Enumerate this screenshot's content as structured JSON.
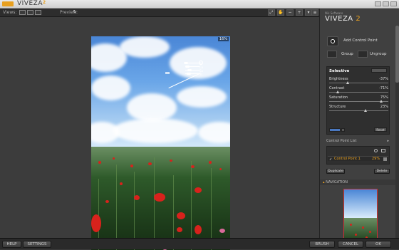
{
  "app": {
    "title": "VIVEZA",
    "version_mark": "2"
  },
  "toolbar": {
    "views_label": "Views:",
    "preview_label": "Preview:"
  },
  "canvas": {
    "zoom": "16%"
  },
  "control_point_tags": [
    "Br",
    "Co",
    "Sa",
    "St"
  ],
  "panel": {
    "brand_small": "Nik Software",
    "brand_name": "VIVEZA",
    "brand_version": "2",
    "add_control_point": "Add Control Point",
    "group": "Group",
    "ungroup": "Ungroup",
    "selective_title": "Selective",
    "sliders": [
      {
        "name": "Brightness",
        "value": "-37%",
        "level": 0.315
      },
      {
        "name": "Contrast",
        "value": "-71%",
        "level": 0.145
      },
      {
        "name": "Saturation",
        "value": "75%",
        "level": 0.875
      },
      {
        "name": "Structure",
        "value": "23%",
        "level": 0.615
      }
    ],
    "reset": "Reset",
    "control_point_list_title": "Control Point List",
    "control_point_row": {
      "check": "✓",
      "name": "Control Point 1",
      "percent": "29%"
    },
    "duplicate": "Duplicate",
    "delete": "Delete",
    "navigation_title": "NAVIGATION"
  },
  "bottom": {
    "help": "HELP",
    "settings": "SETTINGS",
    "brush": "BRUSH",
    "cancel": "CANCEL",
    "ok": "OK"
  },
  "colors": {
    "accent": "#e8a020",
    "selection_blue": "#4a78c0"
  }
}
